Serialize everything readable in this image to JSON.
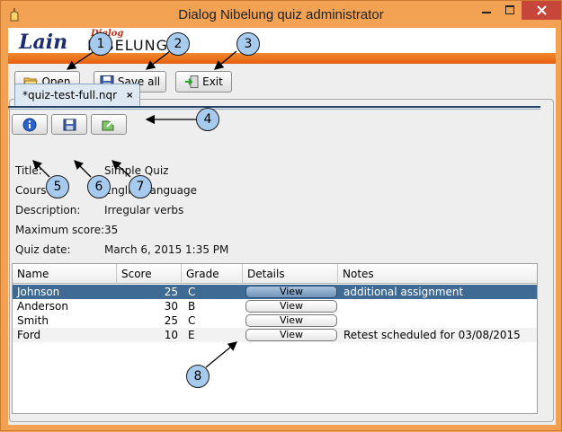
{
  "window": {
    "title": "Dialog Nibelung quiz administrator"
  },
  "logo": {
    "brand": "Lain",
    "product_top": "Dialog",
    "product_main": "NIBELUNG"
  },
  "toolbar": {
    "open_label": "Open",
    "save_all_label": "Save all",
    "exit_label": "Exit"
  },
  "tab": {
    "label": "*quiz-test-full.nqr",
    "close_glyph": "×"
  },
  "quiz": {
    "fields": [
      {
        "label": "Title:",
        "value": "Simple Quiz"
      },
      {
        "label": "Course:",
        "value": "English language"
      },
      {
        "label": "Description:",
        "value": "Irregular verbs"
      },
      {
        "label": "Maximum score:",
        "value": "35"
      },
      {
        "label": "Quiz date:",
        "value": "March 6, 2015 1:35 PM"
      }
    ]
  },
  "table": {
    "columns": [
      "Name",
      "Score",
      "Grade",
      "Details",
      "Notes"
    ],
    "rows": [
      {
        "name": "Johnson",
        "score": "25",
        "grade": "C",
        "details": "View",
        "notes": "additional assignment",
        "selected": true
      },
      {
        "name": "Anderson",
        "score": "30",
        "grade": "B",
        "details": "View",
        "notes": ""
      },
      {
        "name": "Smith",
        "score": "25",
        "grade": "C",
        "details": "View",
        "notes": ""
      },
      {
        "name": "Ford",
        "score": "10",
        "grade": "E",
        "details": "View",
        "notes": "Retest scheduled for 03/08/2015"
      }
    ]
  },
  "callouts": [
    "1",
    "2",
    "3",
    "4",
    "5",
    "6",
    "7",
    "8"
  ],
  "colors": {
    "accent": "#f3a253",
    "selection": "#3e6a94",
    "callout": "#a6cbee"
  }
}
